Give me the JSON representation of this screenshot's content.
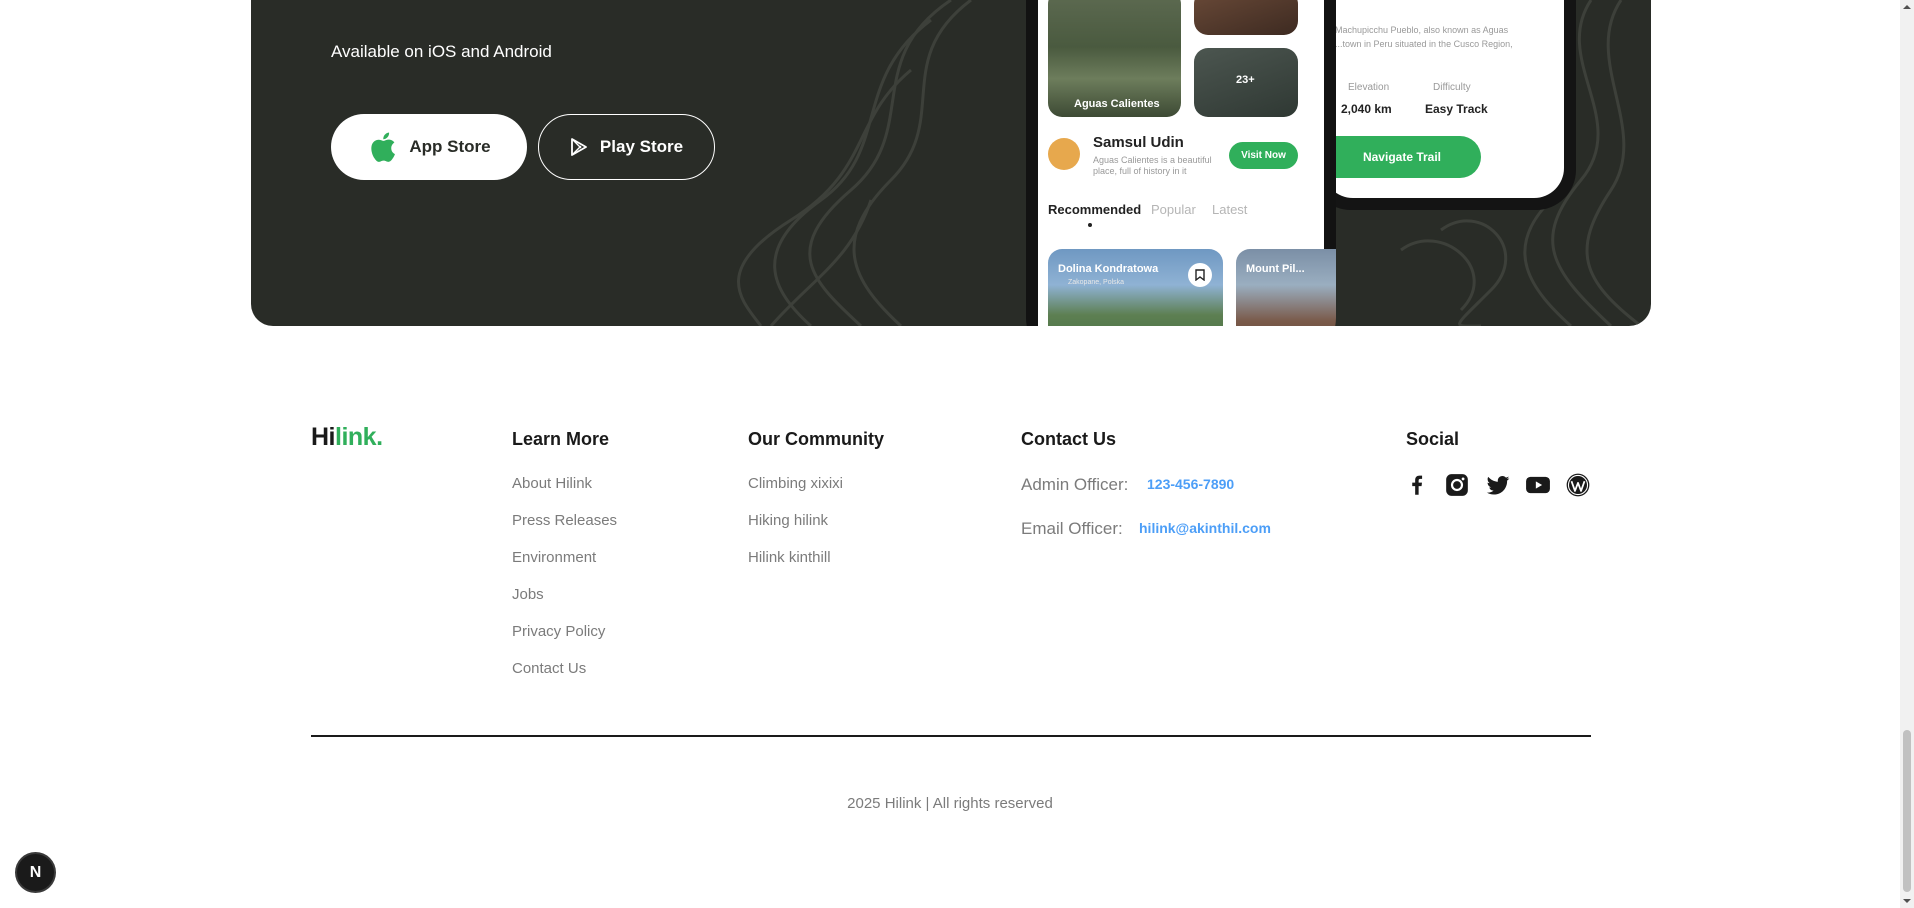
{
  "banner": {
    "available_text": "Available on iOS and Android",
    "app_store_label": "App Store",
    "play_store_label": "Play Store"
  },
  "phone_front": {
    "tile_label": "Aguas Calientes",
    "more_count": "23+",
    "user_name": "Samsul Udin",
    "user_desc_line1": "Aguas Calientes is a beautiful",
    "user_desc_line2": "place, full of history in it",
    "visit_button": "Visit Now",
    "tabs": [
      "Recommended",
      "Popular",
      "Latest"
    ],
    "card1_title": "Dolina Kondratowa",
    "card1_location": "Zakopane, Polska",
    "card2_title": "Mount Pil..."
  },
  "phone_back": {
    "desc_line1": "Machupicchu Pueblo, also known as Aguas",
    "desc_line2": "...town in Peru situated in the Cusco Region,",
    "elevation_label": "Elevation",
    "elevation_value": "2,040 km",
    "difficulty_label": "Difficulty",
    "difficulty_value": "Easy Track",
    "navigate_button": "Navigate Trail"
  },
  "footer": {
    "logo_dark": "Hi",
    "logo_green": "link.",
    "learn_more": {
      "title": "Learn More",
      "links": [
        "About Hilink",
        "Press Releases",
        "Environment",
        "Jobs",
        "Privacy Policy",
        "Contact Us"
      ]
    },
    "community": {
      "title": "Our Community",
      "links": [
        "Climbing xixixi",
        "Hiking hilink",
        "Hilink kinthill"
      ]
    },
    "contact": {
      "title": "Contact Us",
      "admin_label": "Admin Officer:",
      "admin_value": "123-456-7890",
      "email_label": "Email Officer:",
      "email_value": "hilink@akinthil.com"
    },
    "social": {
      "title": "Social",
      "icons": [
        "facebook-icon",
        "instagram-icon",
        "twitter-icon",
        "youtube-icon",
        "wordpress-icon"
      ]
    },
    "copyright": "2025 Hilink | All rights reserved"
  },
  "badge_letter": "N",
  "colors": {
    "banner_bg": "#292c27",
    "accent_green": "#30af5b",
    "link_gray": "#7b7b7b",
    "contact_blue": "#4c9ef7"
  }
}
